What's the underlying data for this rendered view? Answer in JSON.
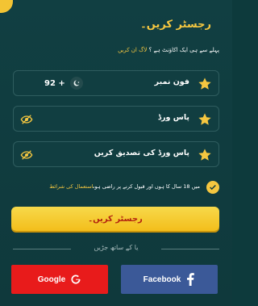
{
  "form": {
    "title": "رجسٹر کریں۔",
    "login_prompt": "پہلے سے ہی ایک اکاؤنٹ ہے ؟",
    "login_link": "لاگ ان کریں",
    "phone_label": "فون نمبر",
    "phone_prefix": "92 +",
    "password_label": "پاس ورڈ",
    "confirm_password_label": "پاس ورڈ کی تصدیق کریں",
    "agree_text": "میں 18 سال کا ہوں اور قبول کرنے پر راضی ہوں",
    "terms_link": "استعمال کی شرائط",
    "register_button": "رجسٹر کریں۔",
    "divider_text": "یا کے ساتھ جڑیں",
    "google_button": "Google",
    "facebook_button": "Facebook"
  },
  "colors": {
    "accent": "#f5c740",
    "background": "#113f42",
    "google": "#e81b1b",
    "facebook": "#3b5998",
    "register_text": "#b3230f"
  },
  "icons": [
    "star-icon",
    "pakistan-flag-icon",
    "eye-off-icon",
    "check-icon",
    "google-icon",
    "facebook-icon"
  ]
}
